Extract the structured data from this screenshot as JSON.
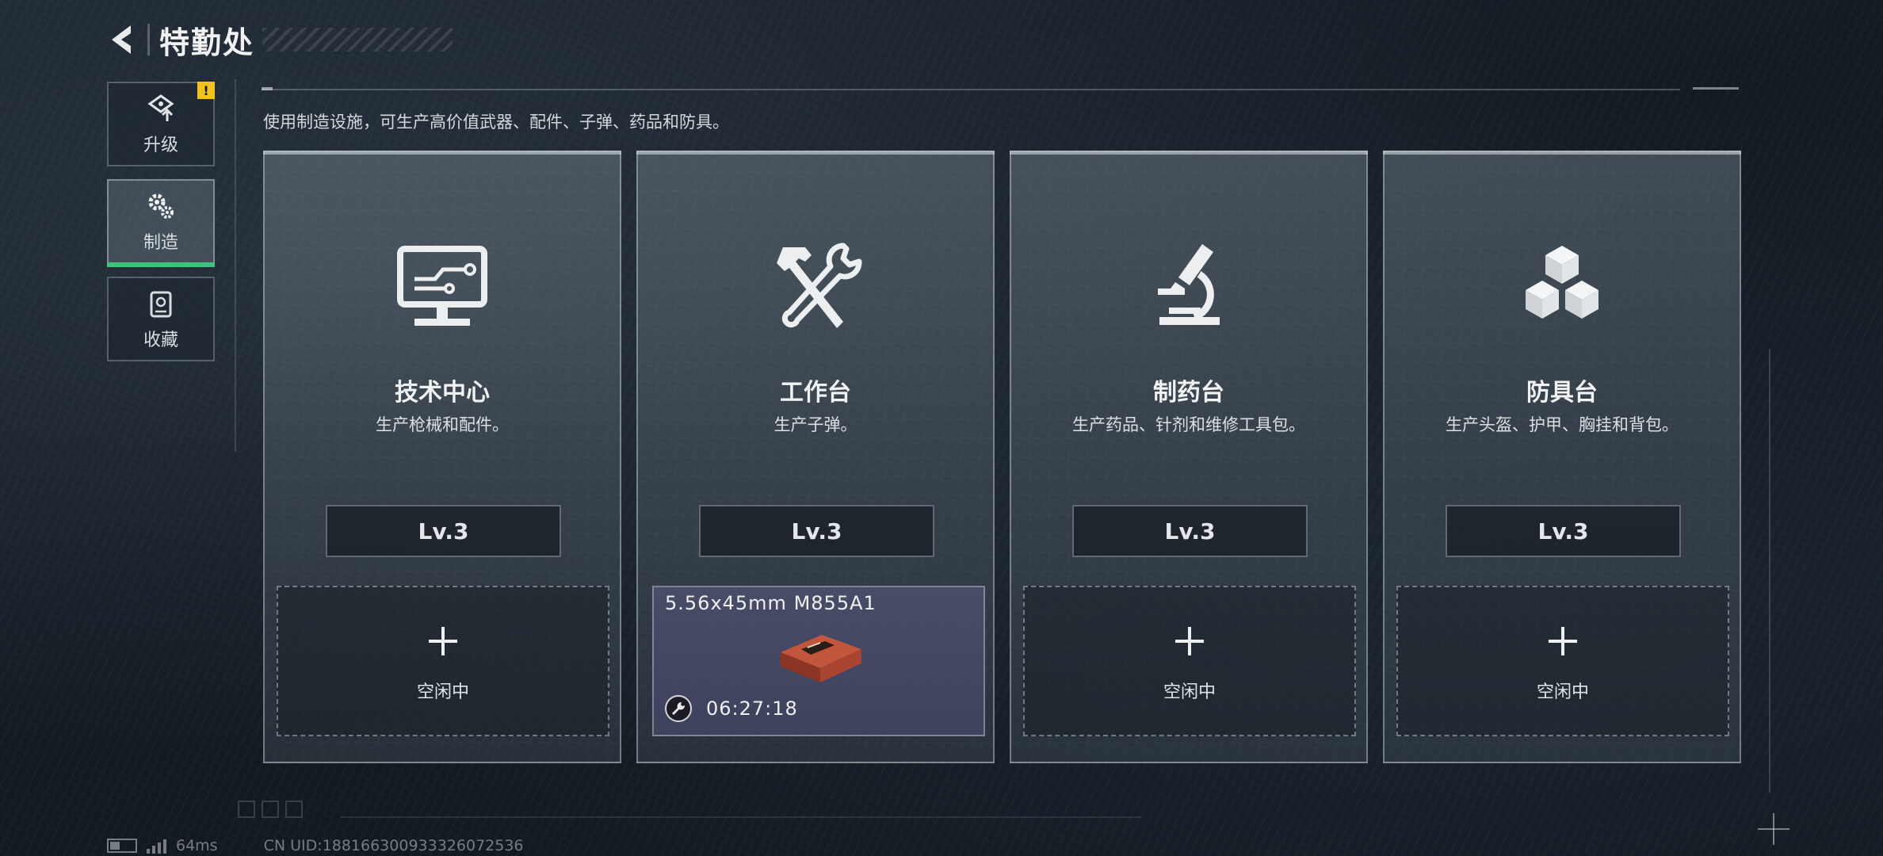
{
  "header": {
    "title": "特勤处"
  },
  "sidebar": {
    "items": [
      {
        "label": "升级",
        "icon": "upgrade-icon",
        "badge": "!"
      },
      {
        "label": "制造",
        "icon": "gears-icon"
      },
      {
        "label": "收藏",
        "icon": "collection-icon"
      }
    ],
    "active_index": 1
  },
  "main": {
    "description": "使用制造设施，可生产高价值武器、配件、子弹、药品和防具。",
    "stations": [
      {
        "title": "技术中心",
        "desc": "生产枪械和配件。",
        "level": "Lv.3",
        "icon": "computer-icon",
        "slot": {
          "idle_label": "空闲中"
        }
      },
      {
        "title": "工作台",
        "desc": "生产子弹。",
        "level": "Lv.3",
        "icon": "hammer-wrench-icon",
        "slot": {
          "item_name": "5.56x45mm M855A1",
          "time_remaining": "06:27:18",
          "item_icon": "ammo-box-icon"
        }
      },
      {
        "title": "制药台",
        "desc": "生产药品、针剂和维修工具包。",
        "level": "Lv.3",
        "icon": "microscope-icon",
        "slot": {
          "idle_label": "空闲中"
        }
      },
      {
        "title": "防具台",
        "desc": "生产头盔、护甲、胸挂和背包。",
        "level": "Lv.3",
        "icon": "cubes-icon",
        "slot": {
          "idle_label": "空闲中"
        }
      }
    ]
  },
  "footer": {
    "ping": "64ms",
    "uid": "CN UID:1881663009333260725​36"
  },
  "colors": {
    "accent_green": "#3ec47a",
    "warning_yellow": "#f3c21e"
  }
}
